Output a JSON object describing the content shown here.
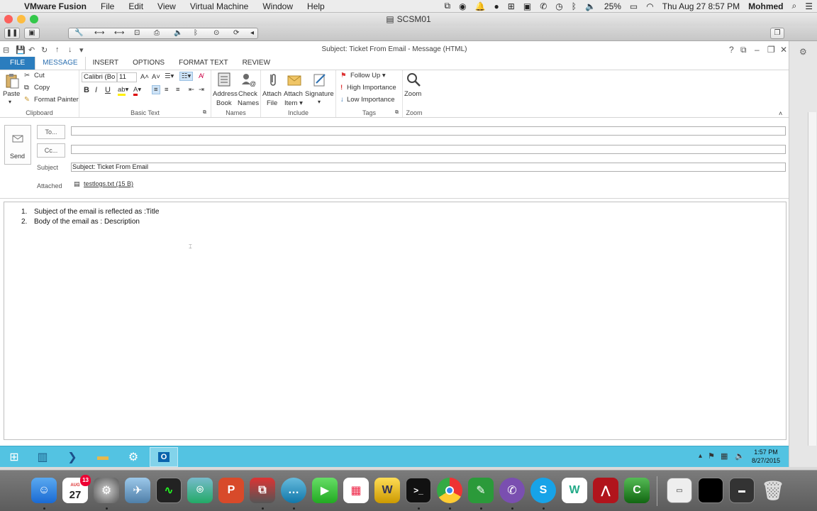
{
  "mac_menubar": {
    "app_name": "VMware Fusion",
    "menus": [
      "File",
      "Edit",
      "View",
      "Virtual Machine",
      "Window",
      "Help"
    ],
    "battery": "25%",
    "datetime": "Thu Aug 27  8:57 PM",
    "user": "Mohmed"
  },
  "vm_window": {
    "title": "SCSM01"
  },
  "outlook": {
    "window_title": "Subject: Ticket From Email  -  Message (HTML)",
    "window_controls": [
      "?",
      "⧉",
      "–",
      "❐",
      "✕"
    ],
    "tabs": [
      "FILE",
      "MESSAGE",
      "INSERT",
      "OPTIONS",
      "FORMAT TEXT",
      "REVIEW"
    ],
    "ribbon": {
      "clipboard": {
        "paste": "Paste",
        "cut": "Cut",
        "copy": "Copy",
        "format_painter": "Format Painter",
        "label": "Clipboard"
      },
      "basic_text": {
        "font": "Calibri (Bo",
        "size": "11",
        "bold": "B",
        "italic": "I",
        "underline": "U",
        "label": "Basic Text"
      },
      "names": {
        "address_book": [
          "Address",
          "Book"
        ],
        "check_names": [
          "Check",
          "Names"
        ],
        "label": "Names"
      },
      "include": {
        "attach_file": [
          "Attach",
          "File"
        ],
        "attach_item": [
          "Attach",
          "Item ▾"
        ],
        "signature": [
          "Signature",
          "▾"
        ],
        "label": "Include"
      },
      "tags": {
        "follow_up": "Follow Up ▾",
        "high_importance": "High Importance",
        "low_importance": "Low Importance",
        "label": "Tags"
      },
      "zoom": {
        "zoom": "Zoom",
        "label": "Zoom"
      }
    },
    "header": {
      "send": "Send",
      "to_button": "To...",
      "cc_button": "Cc...",
      "to_value": "",
      "cc_value": "",
      "subject_label": "Subject",
      "subject_value": "Subject: Ticket From Email",
      "attached_label": "Attached",
      "attachment": "testlogs.txt (15 B)"
    },
    "body_lines": [
      {
        "num": "1.",
        "text": "Subject of the email  is reflected as :Title"
      },
      {
        "num": "2.",
        "text": "Body of the email as : Description"
      }
    ]
  },
  "taskbar": {
    "time": "1:57 PM",
    "date": "8/27/2015"
  },
  "dock": {
    "calendar_month": "AUG",
    "calendar_day": "27",
    "calendar_badge": "13"
  }
}
